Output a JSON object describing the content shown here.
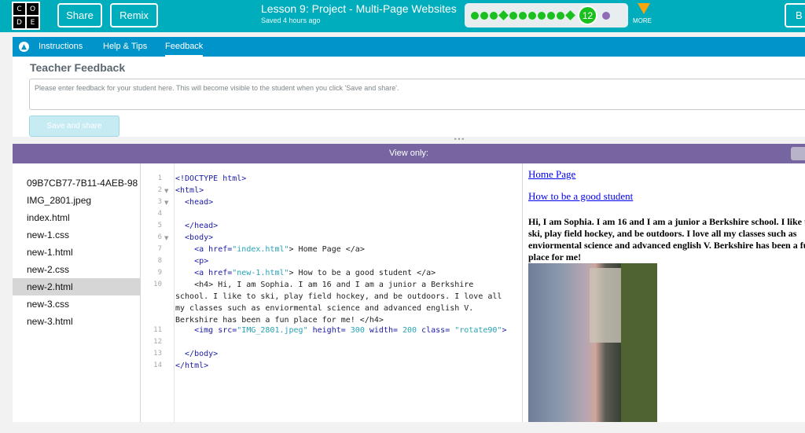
{
  "header": {
    "logo_letters": [
      "C",
      "O",
      "D",
      "E"
    ],
    "share_label": "Share",
    "remix_label": "Remix",
    "lesson_title": "Lesson 9: Project - Multi-Page Websites",
    "saved_text": "Saved 4 hours ago",
    "current_level": "12",
    "more_label": "MORE",
    "edge_button_label": "B"
  },
  "tabs": {
    "instructions": "Instructions",
    "help": "Help & Tips",
    "feedback": "Feedback"
  },
  "feedback": {
    "title": "Teacher Feedback",
    "placeholder": "Please enter feedback for your student here. This will become visible to the student when you click 'Save and share'.",
    "save_label": "Save and share"
  },
  "view_bar": {
    "label": "View only:"
  },
  "files": [
    "09B7CB77-7B11-4AEB-98",
    "IMG_2801.jpeg",
    "index.html",
    "new-1.css",
    "new-1.html",
    "new-2.css",
    "new-2.html",
    "new-3.css",
    "new-3.html"
  ],
  "selected_file": "new-2.html",
  "code": {
    "line_numbers": [
      "1",
      "2",
      "3",
      "4",
      "5",
      "6",
      "7",
      "8",
      "9",
      "10",
      "",
      "",
      "",
      "11",
      "12",
      "13",
      "14"
    ],
    "l1": "<!DOCTYPE html>",
    "l2": "<html>",
    "l3": "  <head>",
    "l5": "  </head>",
    "l6": "  <body>",
    "l7_tag": "    <a ",
    "l7_attr": "href=",
    "l7_val": "\"index.html\"",
    "l7_rest": "> Home Page </a>",
    "l8": "    <p>",
    "l9_tag": "    <a ",
    "l9_attr": "href=",
    "l9_val": "\"new-1.html\"",
    "l9_rest": "> How to be a good student </a>",
    "l10a": "    <h4> Hi, I am Sophia. I am 16 and I am a junior a Berkshire",
    "l10b": "school. I like to ski, play field hockey, and be outdoors. I love all",
    "l10c": "my classes such as enviormental science and advanced english V.",
    "l10d": "Berkshire has been a fun place for me! </h4>",
    "l11_tag": "    <img ",
    "l11_a1": "src=",
    "l11_v1": "\"IMG_2801.jpeg\"",
    "l11_a2": " height= ",
    "l11_v2": "300",
    "l11_a3": " width= ",
    "l11_v3": "200",
    "l11_a4": " class= ",
    "l11_v4": "\"rotate90\"",
    "l11_end": ">",
    "l13": "  </body>",
    "l14": "</html>"
  },
  "preview": {
    "link1": "Home Page",
    "link2": "How to be a good student",
    "heading": "Hi, I am Sophia. I am 16 and I am a junior a Berkshire school. I like to ski, play field hockey, and be outdoors. I love all my classes such as enviormental science and advanced english V. Berkshire has been a fun place for me!"
  }
}
